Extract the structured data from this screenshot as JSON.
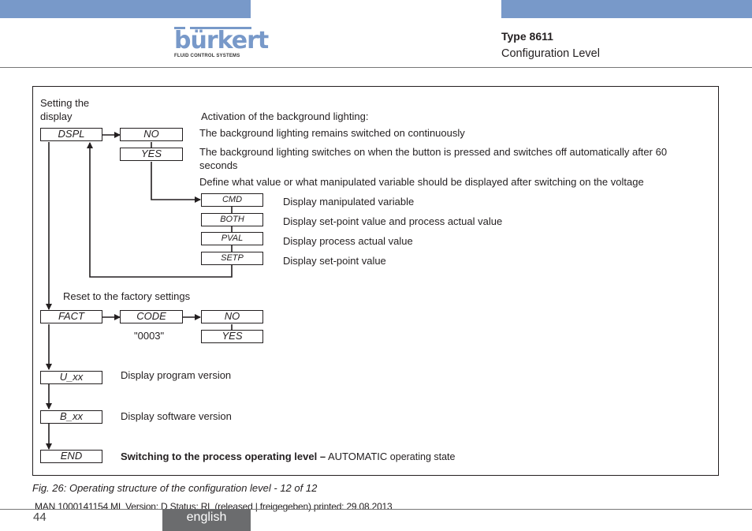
{
  "header": {
    "brand": "bürkert",
    "brand_tagline": "FLUID CONTROL SYSTEMS",
    "title": "Type 8611",
    "subtitle": "Configuration Level",
    "accent_color": "#7899c9"
  },
  "diagram": {
    "dspl_section": {
      "label": "Setting the display",
      "label_line1": "Setting the",
      "label_line2": "display",
      "menu_item": "DSPL",
      "activation_heading": "Activation of the background lighting:",
      "options": [
        {
          "code": "NO",
          "description": "The background lighting remains switched on continuously"
        },
        {
          "code": "YES",
          "description_line1": "The background lighting switches on when the button is pressed and switches off automatically after 60",
          "description_line2": "seconds"
        }
      ],
      "define_text": "Define what value or what manipulated variable should be displayed after switching on the voltage",
      "display_options": [
        {
          "code": "CMD",
          "description": "Display manipulated variable"
        },
        {
          "code": "BOTH",
          "description": "Display set-point value and process actual value"
        },
        {
          "code": "PVAL",
          "description": "Display process actual value"
        },
        {
          "code": "SETP",
          "description": "Display set-point value"
        }
      ]
    },
    "fact_section": {
      "label": "Reset to the factory settings",
      "menu_item": "FACT",
      "code_box": "CODE",
      "code_value": "\"0003\"",
      "options": [
        "NO",
        "YES"
      ]
    },
    "uxx": {
      "menu_item": "U_xx",
      "description": "Display program version"
    },
    "bxx": {
      "menu_item": "B_xx",
      "description": "Display software version"
    },
    "end": {
      "menu_item": "END",
      "description_bold": "Switching to the process operating level –",
      "description_normal": " AUTOMATIC",
      "description_small": " operating state"
    }
  },
  "caption": "Fig. 26:   Operating structure of the configuration level - 12 of 12",
  "footer": {
    "doc_info": "MAN  1000141154  ML  Version: D Status: RL (released | freigegeben)  printed: 29.08.2013",
    "page_number": "44",
    "language": "english"
  }
}
